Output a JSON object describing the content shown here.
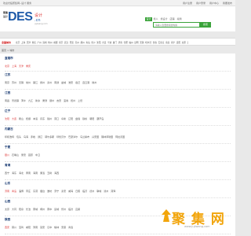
{
  "topbar": {
    "welcome": "欢迎光临聚集网--设计 服务",
    "links": [
      "用户注册",
      "用户登录",
      "用户中心",
      "我要发布"
    ]
  },
  "header": {
    "logo_sq": "聚集设计",
    "logo_text": "DES",
    "logo_cn": ".cn",
    "logo_sheji": "设计",
    "logo_domain": "jujiwang.com",
    "search_tabs": [
      "设计",
      "找人",
      "找设计",
      "店铺",
      "案例"
    ],
    "search_placeholder": "请输入您要搜索的内容",
    "search_button": "搜索"
  },
  "nav": {
    "label": "全国城市",
    "items": [
      "北京",
      "上海",
      "天津",
      "重庆",
      "广州",
      "深圳",
      "杭州",
      "成都",
      "南京",
      "武汉",
      "西安",
      "苏州",
      "郑州",
      "青岛",
      "长沙",
      "沈阳",
      "大连",
      "宁波",
      "厦门",
      "济南",
      "合肥",
      "福州",
      "昆明",
      "无锡",
      "哈尔滨",
      "长春",
      "石家庄",
      "南昌",
      "南宁",
      "贵阳",
      "太原",
      "兰州",
      "海口",
      "乌鲁木齐",
      "呼和浩特",
      "银川",
      "西宁",
      "拉萨"
    ]
  },
  "breadcrumb": "首页 > 城市",
  "provinces": [
    {
      "name": "直辖市",
      "cities": [
        "北京",
        "上海",
        "天津",
        "重庆"
      ],
      "highlight": [
        0,
        1,
        2,
        3
      ]
    },
    {
      "name": "江苏",
      "cities": [
        "南京",
        "苏州",
        "无锡",
        "常州",
        "镇江",
        "扬州",
        "泰州",
        "南通",
        "盐城",
        "淮安",
        "宿迁",
        "连云港",
        "徐州"
      ],
      "highlight": []
    },
    {
      "name": "江西",
      "cities": [
        "南昌",
        "景德镇",
        "萍乡",
        "九江",
        "新余",
        "鹰潭",
        "赣州",
        "吉安",
        "宜春",
        "抚州",
        "上饶"
      ],
      "highlight": []
    },
    {
      "name": "辽宁",
      "cities": [
        "沈阳",
        "大连",
        "鞍山",
        "抚顺",
        "本溪",
        "丹东",
        "锦州",
        "营口",
        "阜新",
        "辽阳",
        "盘锦",
        "铁岭",
        "朝阳",
        "葫芦岛"
      ],
      "highlight": [
        0,
        1
      ]
    },
    {
      "name": "内蒙古",
      "cities": [
        "呼和浩特",
        "包头",
        "乌海",
        "赤峰",
        "通辽",
        "鄂尔多斯",
        "呼伦贝尔",
        "巴彦淖尔",
        "乌兰察布",
        "兴安盟",
        "锡林郭勒盟",
        "阿拉善盟"
      ],
      "highlight": []
    },
    {
      "name": "宁夏",
      "cities": [
        "银川",
        "石嘴山",
        "吴忠",
        "固原",
        "中卫"
      ],
      "highlight": [
        0
      ]
    },
    {
      "name": "青海",
      "cities": [
        "西宁",
        "海东",
        "海北",
        "黄南",
        "海南",
        "果洛",
        "玉树",
        "海西"
      ],
      "highlight": []
    },
    {
      "name": "山东",
      "cities": [
        "济南",
        "青岛",
        "淄博",
        "枣庄",
        "东营",
        "烟台",
        "潍坊",
        "济宁",
        "泰安",
        "威海",
        "日照",
        "临沂",
        "德州",
        "聊城",
        "滨州",
        "菏泽"
      ],
      "highlight": [
        0,
        1
      ]
    },
    {
      "name": "山西",
      "cities": [
        "太原",
        "大同",
        "阳泉",
        "长治",
        "晋城",
        "朔州",
        "晋中",
        "运城",
        "忻州",
        "临汾",
        "吕梁"
      ],
      "highlight": []
    },
    {
      "name": "陕西",
      "cities": [
        "西安",
        "铜川",
        "宝鸡",
        "咸阳",
        "渭南",
        "延安",
        "汉中",
        "榆林",
        "安康",
        "商洛"
      ],
      "highlight": [
        0
      ]
    }
  ],
  "watermark": {
    "text": "聚 集 网",
    "url": "www.jujiwang.com"
  }
}
